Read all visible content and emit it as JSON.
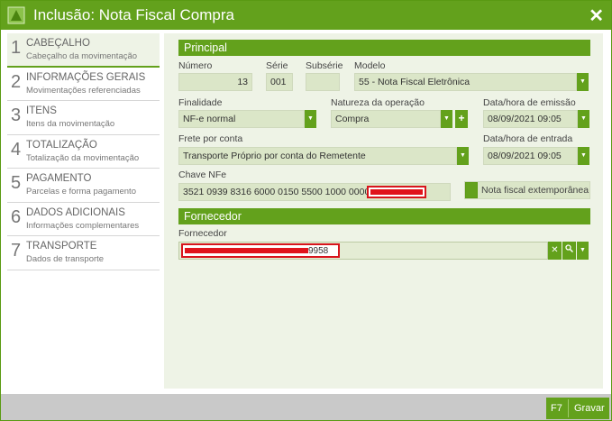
{
  "window": {
    "title": "Inclusão: Nota Fiscal Compra",
    "close_icon": "close-icon"
  },
  "steps": [
    {
      "num": "1",
      "title": "CABEÇALHO",
      "subtitle": "Cabeçalho da movimentação"
    },
    {
      "num": "2",
      "title": "INFORMAÇÕES GERAIS",
      "subtitle": "Movimentações referenciadas"
    },
    {
      "num": "3",
      "title": "ITENS",
      "subtitle": "Itens da movimentação"
    },
    {
      "num": "4",
      "title": "TOTALIZAÇÃO",
      "subtitle": "Totalização da movimentação"
    },
    {
      "num": "5",
      "title": "PAGAMENTO",
      "subtitle": "Parcelas e forma pagamento"
    },
    {
      "num": "6",
      "title": "DADOS ADICIONAIS",
      "subtitle": "Informações complementares"
    },
    {
      "num": "7",
      "title": "TRANSPORTE",
      "subtitle": "Dados de transporte"
    }
  ],
  "principal": {
    "heading": "Principal",
    "numero": {
      "label": "Número",
      "value": "13"
    },
    "serie": {
      "label": "Série",
      "value": "001"
    },
    "subserie": {
      "label": "Subsérie",
      "value": ""
    },
    "modelo": {
      "label": "Modelo",
      "value": "55 - Nota Fiscal Eletrônica"
    },
    "finalidade": {
      "label": "Finalidade",
      "value": "NF-e normal"
    },
    "natureza": {
      "label": "Natureza da operação",
      "value": "Compra",
      "add": "+"
    },
    "emissao": {
      "label": "Data/hora de emissão",
      "value": "08/09/2021 09:05"
    },
    "frete": {
      "label": "Frete por conta",
      "value": "Transporte Próprio por conta do Remetente"
    },
    "entrada": {
      "label": "Data/hora de entrada",
      "value": "08/09/2021 09:05"
    },
    "chave": {
      "label": "Chave NFe",
      "value": "3521 0939 8316 6000 0150 5500 1000 0000"
    },
    "extemporanea": {
      "label": "Nota fiscal extemporânea"
    }
  },
  "fornecedor": {
    "heading": "Fornecedor",
    "label": "Fornecedor",
    "value_visible": "9958",
    "clear": "✕",
    "search": "🔍"
  },
  "footer": {
    "key": "F7",
    "save": "Gravar"
  }
}
